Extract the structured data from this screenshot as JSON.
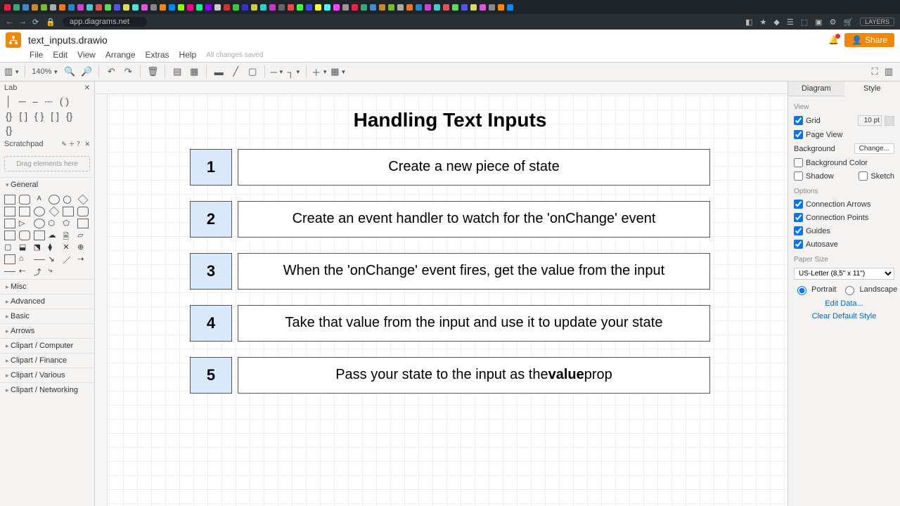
{
  "browser": {
    "url": "app.diagrams.net",
    "layers_btn": "LAYERS"
  },
  "app": {
    "file_name": "text_inputs.drawio",
    "share": "Share",
    "saved": "All changes saved"
  },
  "menu": [
    "File",
    "Edit",
    "View",
    "Arrange",
    "Extras",
    "Help"
  ],
  "toolbar": {
    "zoom": "140%"
  },
  "left": {
    "search": "Lab",
    "scratchpad": "Scratchpad",
    "dropzone": "Drag elements here",
    "categories": [
      "General",
      "Misc",
      "Advanced",
      "Basic",
      "Arrows",
      "Clipart / Computer",
      "Clipart / Finance",
      "Clipart / Various",
      "Clipart / Networking"
    ]
  },
  "diagram": {
    "title": "Handling Text Inputs",
    "steps": [
      {
        "n": "1",
        "text": "Create a new piece of state"
      },
      {
        "n": "2",
        "text": "Create an event handler to watch for the 'onChange' event"
      },
      {
        "n": "3",
        "text": "When the 'onChange' event fires, get the value from the input"
      },
      {
        "n": "4",
        "text": "Take that value from the input and use it to update your state"
      },
      {
        "n": "5",
        "html": "Pass your state to the input as the <b>value</b> prop"
      }
    ]
  },
  "right": {
    "tabs": [
      "Diagram",
      "Style"
    ],
    "active_tab": 1,
    "view": "View",
    "grid": "Grid",
    "grid_size": "10 pt",
    "page_view": "Page View",
    "background": "Background",
    "change": "Change...",
    "bg_color": "Background Color",
    "shadow": "Shadow",
    "sketch": "Sketch",
    "options": "Options",
    "conn_arrows": "Connection Arrows",
    "conn_points": "Connection Points",
    "guides": "Guides",
    "autosave": "Autosave",
    "paper_size": "Paper Size",
    "paper_value": "US-Letter (8,5\" x 11\")",
    "portrait": "Portrait",
    "landscape": "Landscape",
    "edit_data": "Edit Data...",
    "clear_default": "Clear Default Style"
  },
  "tab_colors": [
    "#e24",
    "#3a7",
    "#48c",
    "#c82",
    "#7b3",
    "#aaa",
    "#e72",
    "#28c",
    "#c4c",
    "#4cc",
    "#d55",
    "#5d5",
    "#55d",
    "#dd5",
    "#5dd",
    "#d5d",
    "#888",
    "#f80",
    "#08f",
    "#8f0",
    "#f08",
    "#0f8",
    "#80f",
    "#ccc",
    "#c33",
    "#3c3",
    "#33c",
    "#cc3",
    "#3cc",
    "#c3c",
    "#666",
    "#f44",
    "#4f4",
    "#44f",
    "#ff4",
    "#4ff",
    "#f4f",
    "#999",
    "#e24",
    "#3a7",
    "#48c",
    "#c82",
    "#7b3",
    "#aaa",
    "#e72",
    "#28c",
    "#c4c",
    "#4cc",
    "#d55",
    "#5d5",
    "#55d",
    "#dd5",
    "#d5d",
    "#888",
    "#f80",
    "#08f"
  ]
}
